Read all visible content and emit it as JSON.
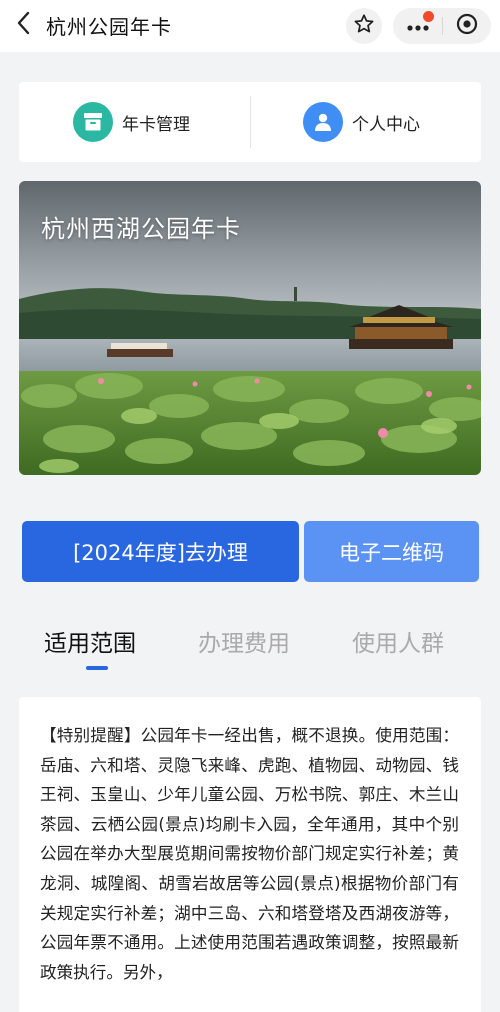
{
  "header": {
    "title": "杭州公园年卡"
  },
  "entries": {
    "annual_card_label": "年卡管理",
    "personal_center_label": "个人中心"
  },
  "banner": {
    "title": "杭州西湖公园年卡"
  },
  "actions": {
    "apply_label": "[2024年度]去办理",
    "qr_label": "电子二维码"
  },
  "tabs": [
    {
      "label": "适用范围",
      "active": true
    },
    {
      "label": "办理费用",
      "active": false
    },
    {
      "label": "使用人群",
      "active": false
    }
  ],
  "content": {
    "text": "【特别提醒】公园年卡一经出售，概不退换。使用范围：岳庙、六和塔、灵隐飞来峰、虎跑、植物园、动物园、钱王祠、玉皇山、少年儿童公园、万松书院、郭庄、木兰山茶园、云栖公园(景点)均刷卡入园，全年通用，其中个别公园在举办大型展览期间需按物价部门规定实行补差；黄龙洞、城隍阁、胡雪岩故居等公园(景点)根据物价部门有关规定实行补差；湖中三岛、六和塔登塔及西湖夜游等，公园年票不通用。上述使用范围若遇政策调整，按照最新政策执行。另外，"
  },
  "colors": {
    "primary": "#2867e0",
    "secondary_button": "#5b93f5",
    "annual_icon": "#2bb8a3",
    "personal_icon": "#3f8ef5",
    "badge": "#f04a2a"
  },
  "icons": [
    "back-arrow-icon",
    "star-icon",
    "more-icon",
    "close-circle-icon",
    "card-box-icon",
    "user-icon"
  ]
}
